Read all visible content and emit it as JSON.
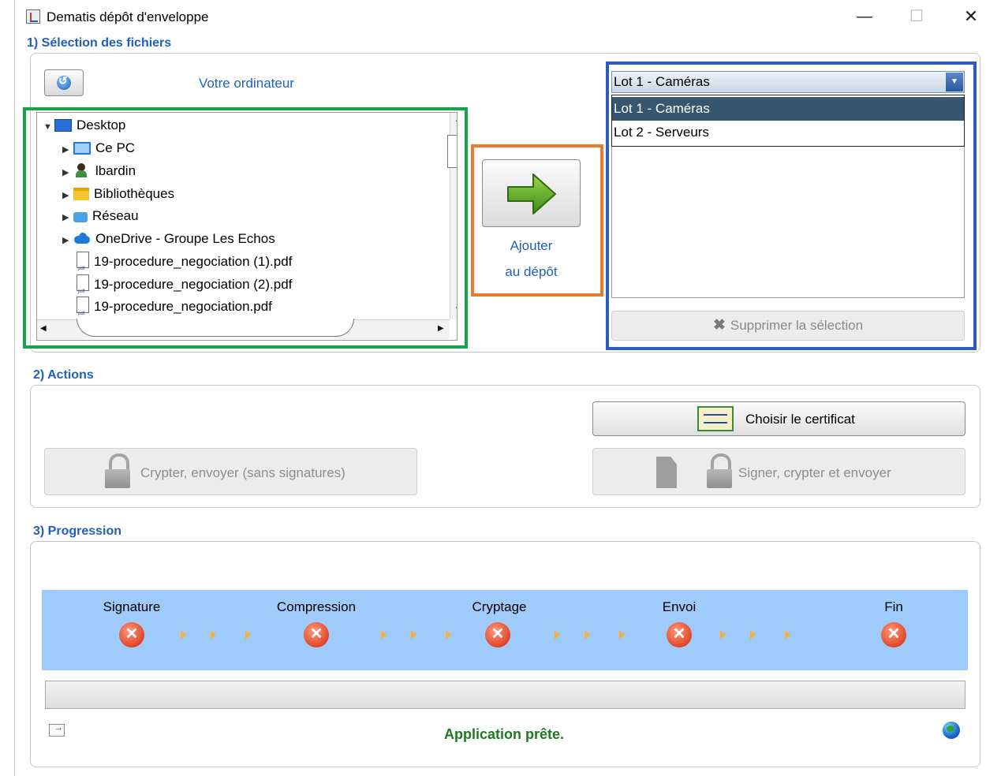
{
  "window": {
    "title": "Dematis dépôt d'enveloppe",
    "controls": {
      "minimize": "—",
      "maximize": "☐",
      "close": "✕"
    }
  },
  "section1": {
    "label": "1) Sélection des fichiers",
    "computer_label": "Votre ordinateur",
    "tree": [
      {
        "label": "Desktop",
        "icon": "desktop-icon",
        "expanded": true,
        "level": 0
      },
      {
        "label": "Ce PC",
        "icon": "computer-icon",
        "expanded": false,
        "level": 1
      },
      {
        "label": "lbardin",
        "icon": "user-icon",
        "expanded": false,
        "level": 1
      },
      {
        "label": "Bibliothèques",
        "icon": "library-icon",
        "expanded": false,
        "level": 1
      },
      {
        "label": "Réseau",
        "icon": "network-icon",
        "expanded": false,
        "level": 1
      },
      {
        "label": "OneDrive - Groupe Les Echos",
        "icon": "cloud-icon",
        "expanded": false,
        "level": 1
      },
      {
        "label": "19-procedure_negociation (1).pdf",
        "icon": "pdf-icon",
        "level": 1
      },
      {
        "label": "19-procedure_negociation (2).pdf",
        "icon": "pdf-icon",
        "level": 1
      },
      {
        "label": "19-procedure_negociation.pdf",
        "icon": "pdf-icon",
        "level": 1
      }
    ],
    "add_button": {
      "line1": "Ajouter",
      "line2": "au dépôt"
    },
    "lot_selector": {
      "selected": "Lot 1  - Caméras",
      "options": [
        "Lot 1  - Caméras",
        "Lot 2  - Serveurs"
      ]
    },
    "delete_button": "Supprimer la sélection"
  },
  "section2": {
    "label": "2) Actions",
    "choose_cert": "Choisir le certificat",
    "encrypt_send": "Crypter, envoyer (sans signatures)",
    "sign_encrypt_send": "Signer, crypter et envoyer"
  },
  "section3": {
    "label": "3) Progression",
    "steps": [
      "Signature",
      "Compression",
      "Cryptage",
      "Envoi",
      "Fin"
    ],
    "step_state": "error",
    "progress": 0,
    "status": "Application prête."
  },
  "colors": {
    "accent_blue": "#1f5fbf",
    "highlight_green": "#16a34a",
    "highlight_orange": "#ea7b2c",
    "highlight_blue": "#2e5cbe",
    "steps_bg": "#9ecbf9",
    "status_green": "#1e7a1e"
  }
}
